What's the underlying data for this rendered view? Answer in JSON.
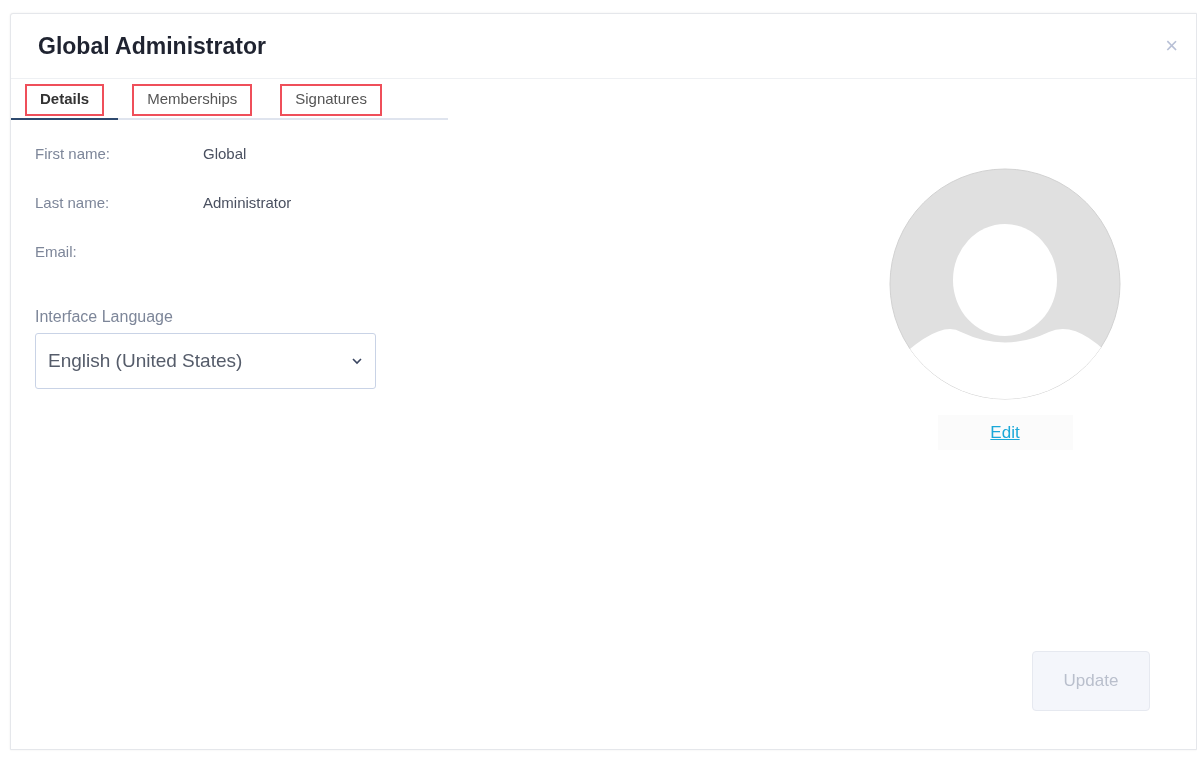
{
  "dialog": {
    "title": "Global Administrator",
    "close": "×"
  },
  "tabs": [
    {
      "label": "Details",
      "selected": true,
      "highlighted": true
    },
    {
      "label": "Memberships",
      "selected": false,
      "highlighted": true
    },
    {
      "label": "Signatures",
      "selected": false,
      "highlighted": true
    }
  ],
  "fields": [
    {
      "label": "First name:",
      "value": "Global"
    },
    {
      "label": "Last name:",
      "value": "Administrator"
    },
    {
      "label": "Email:"
    }
  ],
  "language": {
    "label": "Interface Language",
    "value": "English (United States)"
  },
  "avatar": {
    "edit_link": "Edit"
  },
  "update_button": {
    "label": "Update",
    "disabled": true
  }
}
